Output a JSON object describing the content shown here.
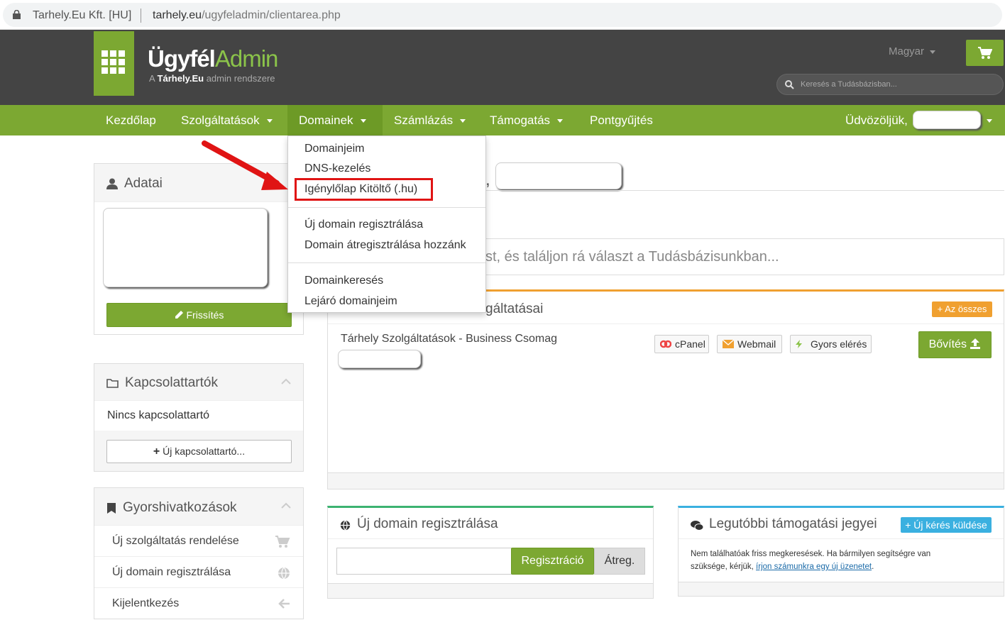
{
  "browser": {
    "site": "Tarhely.Eu Kft. [HU]",
    "domain": "tarhely.eu",
    "path": "/ugyfeladmin/clientarea.php"
  },
  "header": {
    "logo_main": "Ügyfél",
    "logo_accent": "Admin",
    "logo_sub_prefix": "A ",
    "logo_sub_brand": "Tárhely.Eu",
    "logo_sub_suffix": " admin rendszere",
    "language": "Magyar",
    "search_placeholder": "Keresés a Tudásbázisban..."
  },
  "nav": {
    "items": [
      "Kezdőlap",
      "Szolgáltatások",
      "Domainek",
      "Számlázás",
      "Támogatás",
      "Pontgyűjtés"
    ],
    "greeting": "Üdvözöljük,"
  },
  "dropdown": {
    "items": [
      "Domainjeim",
      "DNS-kezelés",
      "Igénylőlap Kitöltő (.hu)",
      "Új domain regisztrálása",
      "Domain átregisztrálása hozzánk",
      "Domainkeresés",
      "Lejáró domainjeim"
    ]
  },
  "sidebar": {
    "adatai_title": "Adatai",
    "refresh_label": "Frissítés",
    "contacts_title": "Kapcsolattartók",
    "contacts_empty": "Nincs kapcsolattartó",
    "new_contact_label": "Új kapcsolattartó...",
    "shortcuts_title": "Gyorshivatkozások",
    "shortcuts": [
      "Új szolgáltatás rendelése",
      "Új domain regisztrálása",
      "Kijelentkezés"
    ]
  },
  "main": {
    "welcome_comma": ",",
    "kb_search_text": "st, és találjon rá választ a Tudásbázisunkban...",
    "services_title": "gáltatásai",
    "view_all_label": "Az összes",
    "service_name": "Tárhely Szolgáltatások - Business Csomag",
    "chips": [
      "cPanel",
      "Webmail",
      "Gyors elérés"
    ],
    "upgrade_label": "Bővítés",
    "domain_panel_title": "Új domain regisztrálása",
    "register_label": "Regisztráció",
    "transfer_label": "Átreg.",
    "tickets_title": "Legutóbbi támogatási jegyei",
    "new_ticket_label": "Új kérés küldése",
    "tickets_text_1": "Nem találhatóak friss megkeresések. Ha bármilyen segítségre van",
    "tickets_text_2": "szüksége, kérjük, ",
    "tickets_link": "írjon számunkra egy új üzenetet",
    "tickets_text_3": "."
  },
  "colors": {
    "brand_green": "#7ca832",
    "header_dark": "#444444",
    "highlight_red": "#e01414",
    "orange": "#f0a030",
    "blue": "#3ab0e0"
  }
}
